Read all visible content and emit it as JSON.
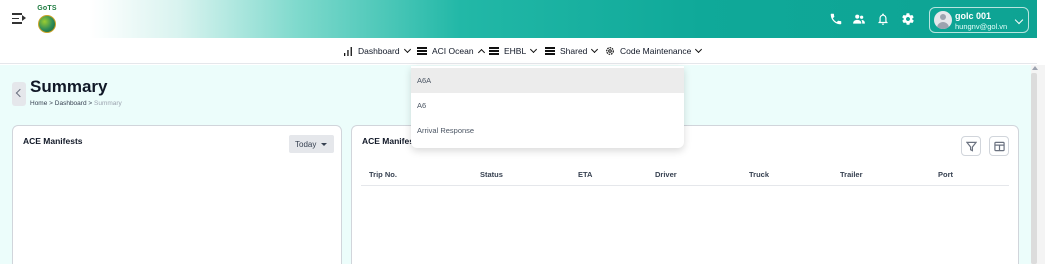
{
  "header": {
    "logo_text": "GoTS",
    "user": {
      "name": "golc 001",
      "email": "hungnv@gol.vn"
    }
  },
  "nav": {
    "items": [
      {
        "label": "Dashboard"
      },
      {
        "label": "ACI Ocean"
      },
      {
        "label": "EHBL"
      },
      {
        "label": "Shared"
      },
      {
        "label": "Code Maintenance"
      }
    ],
    "dropdown": [
      "A6A",
      "A6",
      "Arrival Response"
    ]
  },
  "page": {
    "title": "Summary",
    "breadcrumb": [
      "Home",
      "Dashboard",
      "Summary"
    ]
  },
  "cards": {
    "ace": {
      "title": "ACE Manifests",
      "filter": "Today"
    },
    "aci": {
      "title": "ACE Manifests",
      "columns": [
        "Trip No.",
        "Status",
        "ETA",
        "Driver",
        "Truck",
        "Trailer",
        "Port"
      ]
    }
  },
  "colors": {
    "accent": "#0fa999",
    "content_bg": "#ecfdfb"
  }
}
